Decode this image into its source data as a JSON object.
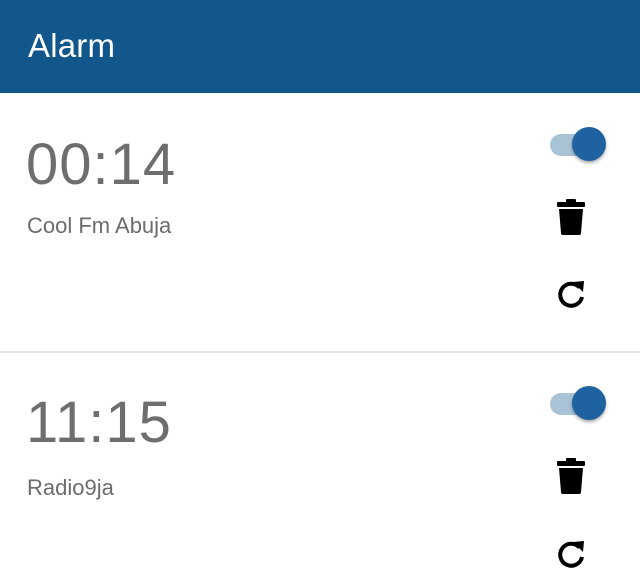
{
  "appbar": {
    "title": "Alarm",
    "color": "#12578b"
  },
  "alarms": [
    {
      "time": "00:14",
      "station": "Cool Fm Abuja",
      "enabled": true,
      "icons": [
        "toggle-switch",
        "trash-icon",
        "refresh-icon"
      ]
    },
    {
      "time": "11:15",
      "station": "Radio9ja",
      "enabled": true,
      "icons": [
        "toggle-switch",
        "trash-icon",
        "refresh-icon"
      ]
    }
  ],
  "colors": {
    "switch_thumb": "#1f62a0",
    "switch_track": "#a9c3d6",
    "text": "#6e6e6e"
  }
}
